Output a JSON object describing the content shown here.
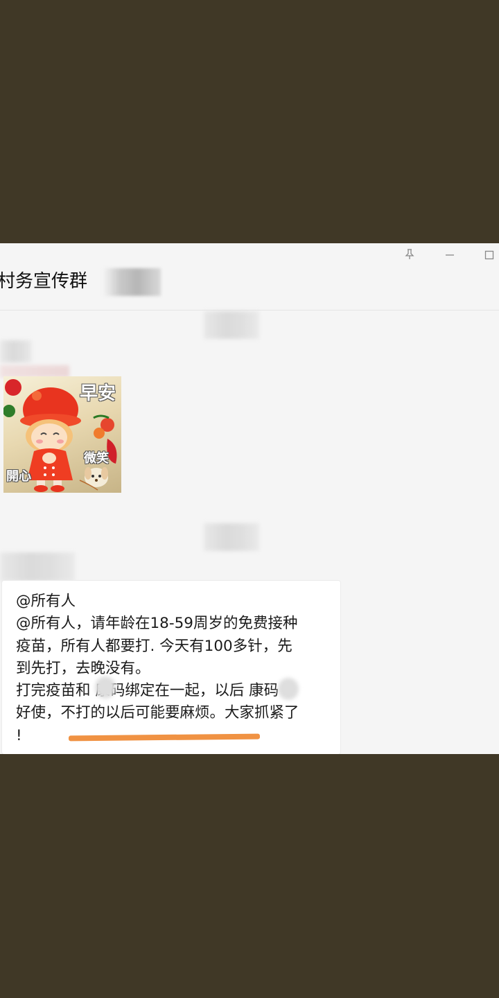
{
  "window": {
    "title": "村务宣传群",
    "controls": [
      "pin-icon",
      "minimize-icon",
      "maximize-icon"
    ]
  },
  "sticker": {
    "greeting": "早安",
    "smile": "微笑",
    "happy": "開心"
  },
  "message": {
    "lines": [
      "@所有人",
      "@所有人，请年龄在18-59周岁的免费接种",
      "疫苗，所有人都要打. 今天有100多针，先",
      "到先打，去晚没有。",
      "打完疫苗和    康码绑定在一起，以后    康码",
      "好使，不打的以后可能要麻烦。大家抓紧了",
      "!"
    ]
  },
  "colors": {
    "background": "#403826",
    "window": "#f5f5f5",
    "bubble": "#ffffff",
    "underline": "#f09243"
  }
}
